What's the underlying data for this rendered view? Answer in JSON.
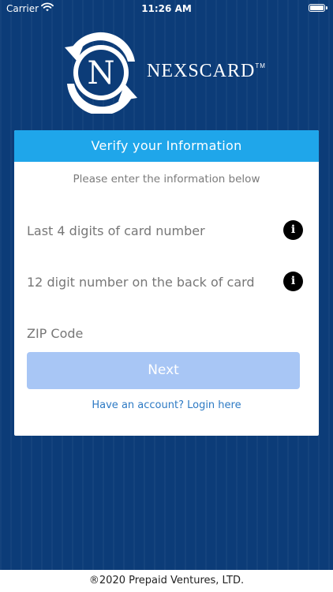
{
  "status_bar": {
    "carrier": "Carrier",
    "time": "11:26 AM",
    "wifi_icon": "wifi-icon",
    "battery_icon": "battery-icon"
  },
  "brand": {
    "name": "NEXSCARD",
    "trademark": "TM",
    "logo_letter": "N",
    "logo_icon": "nexscard-logo-icon"
  },
  "card": {
    "header_title": "Verify your Information",
    "instructions": "Please enter the information below",
    "fields": {
      "card_last4": {
        "placeholder": "Last 4 digits of card number",
        "value": "",
        "info_icon": "info-icon",
        "info_glyph": "i"
      },
      "back_12": {
        "placeholder": "12 digit number on the back of card",
        "value": "",
        "info_icon": "info-icon",
        "info_glyph": "i"
      },
      "zip": {
        "placeholder": "ZIP Code",
        "value": ""
      }
    },
    "next_label": "Next",
    "login_link": "Have an account? Login here"
  },
  "footer": {
    "copyright": "®2020 Prepaid Ventures, LTD."
  },
  "colors": {
    "background": "#0c3c78",
    "header": "#1fa6ea",
    "next_button": "#a8c6f5",
    "link": "#2d7ac4"
  }
}
